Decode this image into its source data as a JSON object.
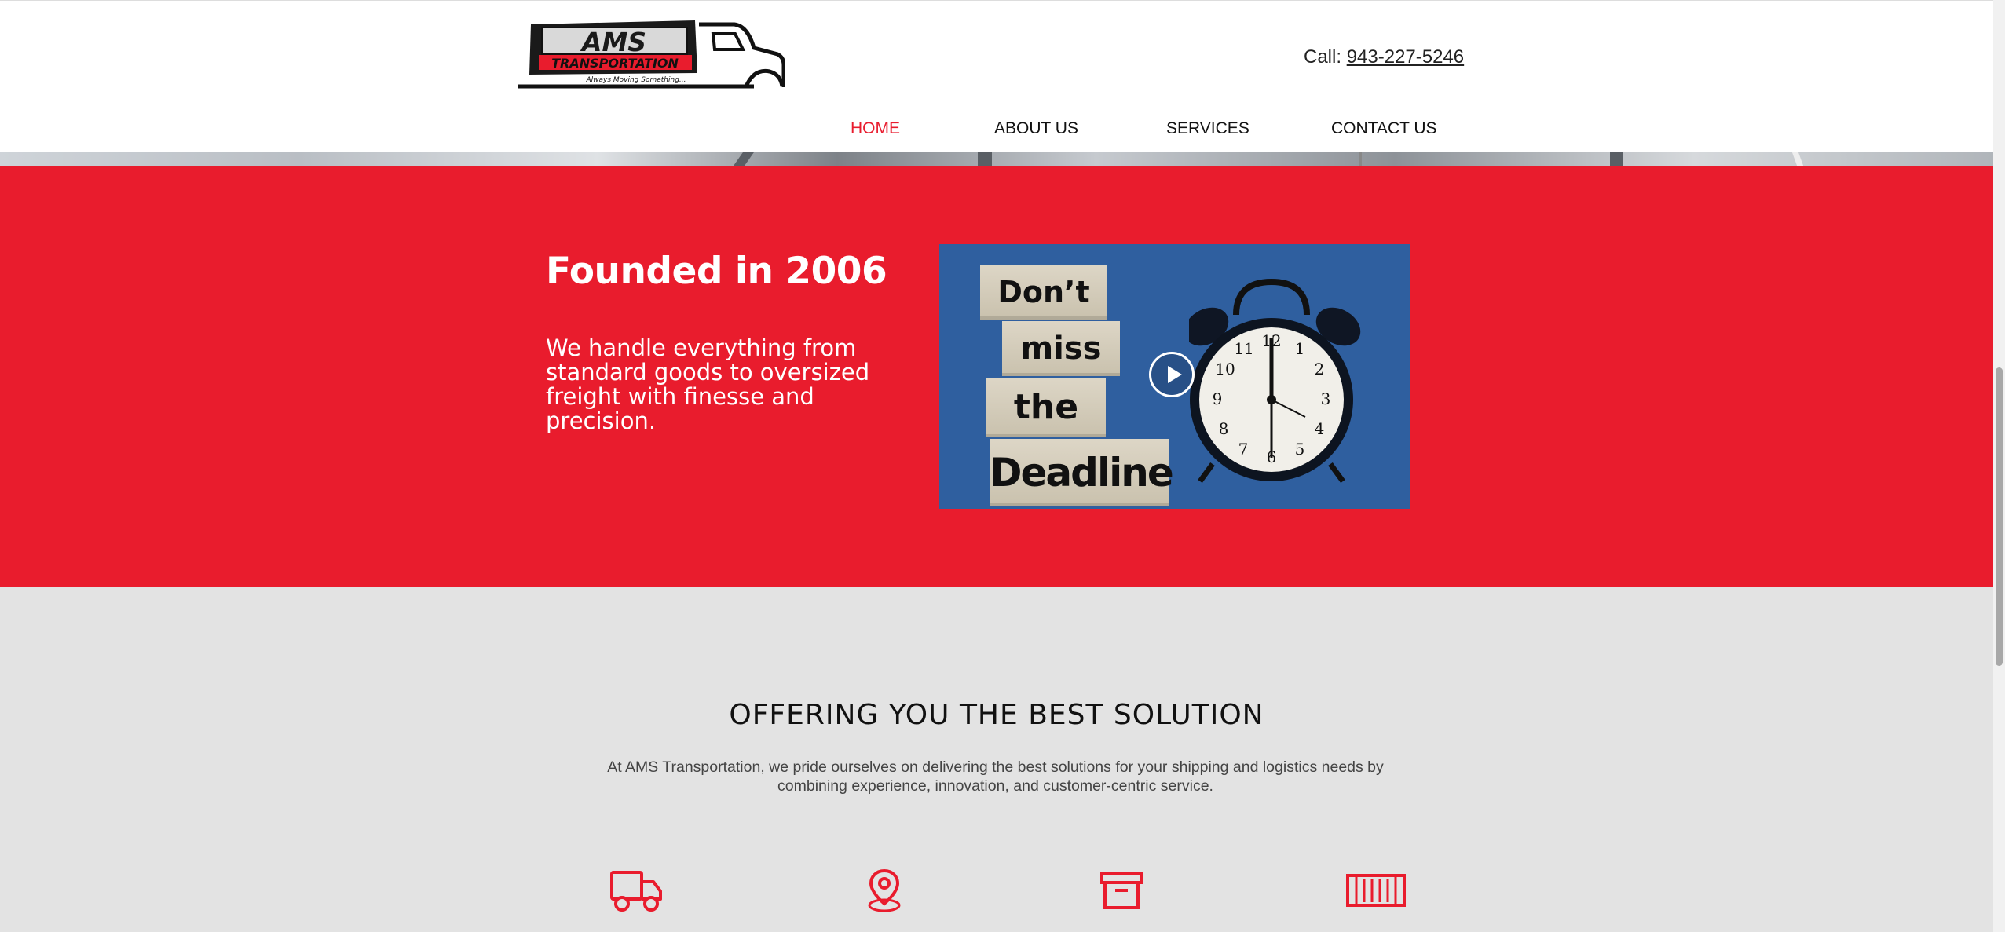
{
  "brand": {
    "logo_name": "AMS",
    "logo_sub": "TRANSPORTATION",
    "logo_tagline": "Always Moving Something..."
  },
  "header": {
    "call_label": "Call:",
    "phone": "943-227-5246"
  },
  "nav": {
    "items": [
      {
        "label": "HOME",
        "active": true
      },
      {
        "label": "ABOUT US",
        "active": false
      },
      {
        "label": "SERVICES",
        "active": false
      },
      {
        "label": "CONTACT US",
        "active": false
      }
    ]
  },
  "hero": {
    "title": "Founded in 2006",
    "text": "We handle everything from standard goods to oversized freight with finesse and precision.",
    "video": {
      "blocks": [
        "Don’t",
        "miss",
        "the",
        "Deadline !"
      ],
      "icons": [
        "play-icon",
        "alarm-clock-icon"
      ]
    }
  },
  "offering": {
    "title": "OFFERING YOU THE BEST SOLUTION",
    "text": "At AMS Transportation, we pride ourselves on delivering the best solutions for your shipping and logistics needs by combining experience, innovation, and customer-centric service.",
    "icons": [
      "truck-icon",
      "location-pin-icon",
      "archive-box-icon",
      "shipping-container-icon"
    ]
  },
  "colors": {
    "brand_red": "#e91c2d",
    "nav_active": "#e81c2e",
    "section_grey": "#e3e3e3"
  }
}
